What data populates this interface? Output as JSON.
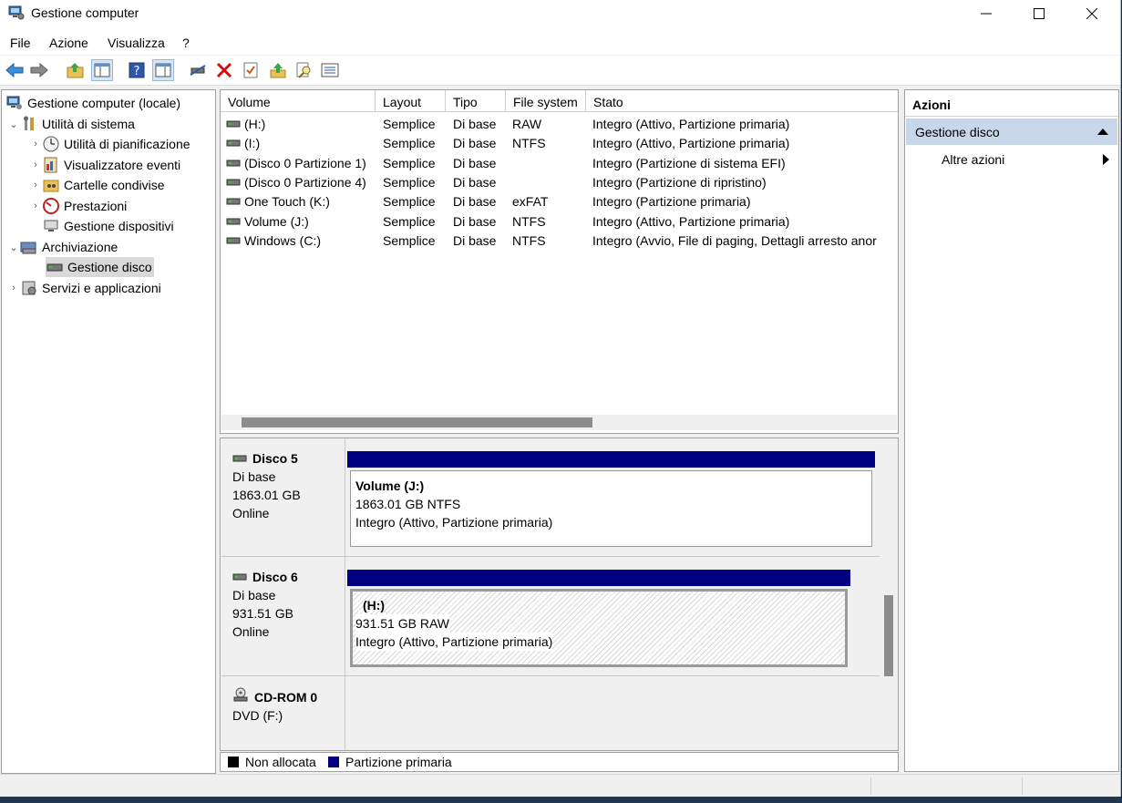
{
  "window": {
    "title": "Gestione computer"
  },
  "menu": [
    "File",
    "Azione",
    "Visualizza",
    "?"
  ],
  "toolbar": {
    "icons": [
      "back-arrow-icon",
      "forward-arrow-icon",
      "up-folder-icon",
      "show-hide-console-tree-icon",
      "help-icon",
      "show-hide-action-pane-icon",
      "connect-drive-icon",
      "delete-icon",
      "properties-icon",
      "export-icon",
      "search-icon",
      "list-view-icon"
    ]
  },
  "tree": {
    "root": "Gestione computer (locale)",
    "system_tools": "Utilità di sistema",
    "task_scheduler": "Utilità di pianificazione",
    "event_viewer": "Visualizzatore eventi",
    "shared_folders": "Cartelle condivise",
    "performance": "Prestazioni",
    "device_manager": "Gestione dispositivi",
    "storage": "Archiviazione",
    "disk_management": "Gestione disco",
    "services": "Servizi e applicazioni"
  },
  "volumes": {
    "columns": [
      "Volume",
      "Layout",
      "Tipo",
      "File system",
      "Stato"
    ],
    "rows": [
      {
        "volume": "(H:)",
        "layout": "Semplice",
        "type": "Di base",
        "fs": "RAW",
        "status": "Integro (Attivo, Partizione primaria)"
      },
      {
        "volume": "(I:)",
        "layout": "Semplice",
        "type": "Di base",
        "fs": "NTFS",
        "status": "Integro (Attivo, Partizione primaria)"
      },
      {
        "volume": "(Disco 0 Partizione 1)",
        "layout": "Semplice",
        "type": "Di base",
        "fs": "",
        "status": "Integro (Partizione di sistema EFI)"
      },
      {
        "volume": "(Disco 0 Partizione 4)",
        "layout": "Semplice",
        "type": "Di base",
        "fs": "",
        "status": "Integro (Partizione di ripristino)"
      },
      {
        "volume": "One Touch (K:)",
        "layout": "Semplice",
        "type": "Di base",
        "fs": "exFAT",
        "status": "Integro (Partizione primaria)"
      },
      {
        "volume": "Volume (J:)",
        "layout": "Semplice",
        "type": "Di base",
        "fs": "NTFS",
        "status": "Integro (Attivo, Partizione primaria)"
      },
      {
        "volume": "Windows (C:)",
        "layout": "Semplice",
        "type": "Di base",
        "fs": "NTFS",
        "status": "Integro (Avvio, File di paging, Dettagli arresto anor"
      }
    ]
  },
  "disks": {
    "disk5": {
      "name": "Disco 5",
      "type": "Di base",
      "size": "1863.01 GB",
      "state": "Online",
      "partition": {
        "title": "Volume  (J:)",
        "size_fs": "1863.01 GB NTFS",
        "status": "Integro (Attivo, Partizione primaria)"
      }
    },
    "disk6": {
      "name": "Disco 6",
      "type": "Di base",
      "size": "931.51 GB",
      "state": "Online",
      "partition": {
        "title": "(H:)",
        "size_fs": "931.51 GB RAW",
        "status": "Integro (Attivo, Partizione primaria)"
      }
    },
    "cdrom": {
      "name": "CD-ROM 0",
      "drive": "DVD (F:)"
    }
  },
  "legend": {
    "unallocated": "Non allocata",
    "primary": "Partizione primaria",
    "unallocated_color": "#000000",
    "primary_color": "#000080"
  },
  "actions": {
    "header": "Azioni",
    "section": "Gestione disco",
    "more": "Altre azioni"
  }
}
